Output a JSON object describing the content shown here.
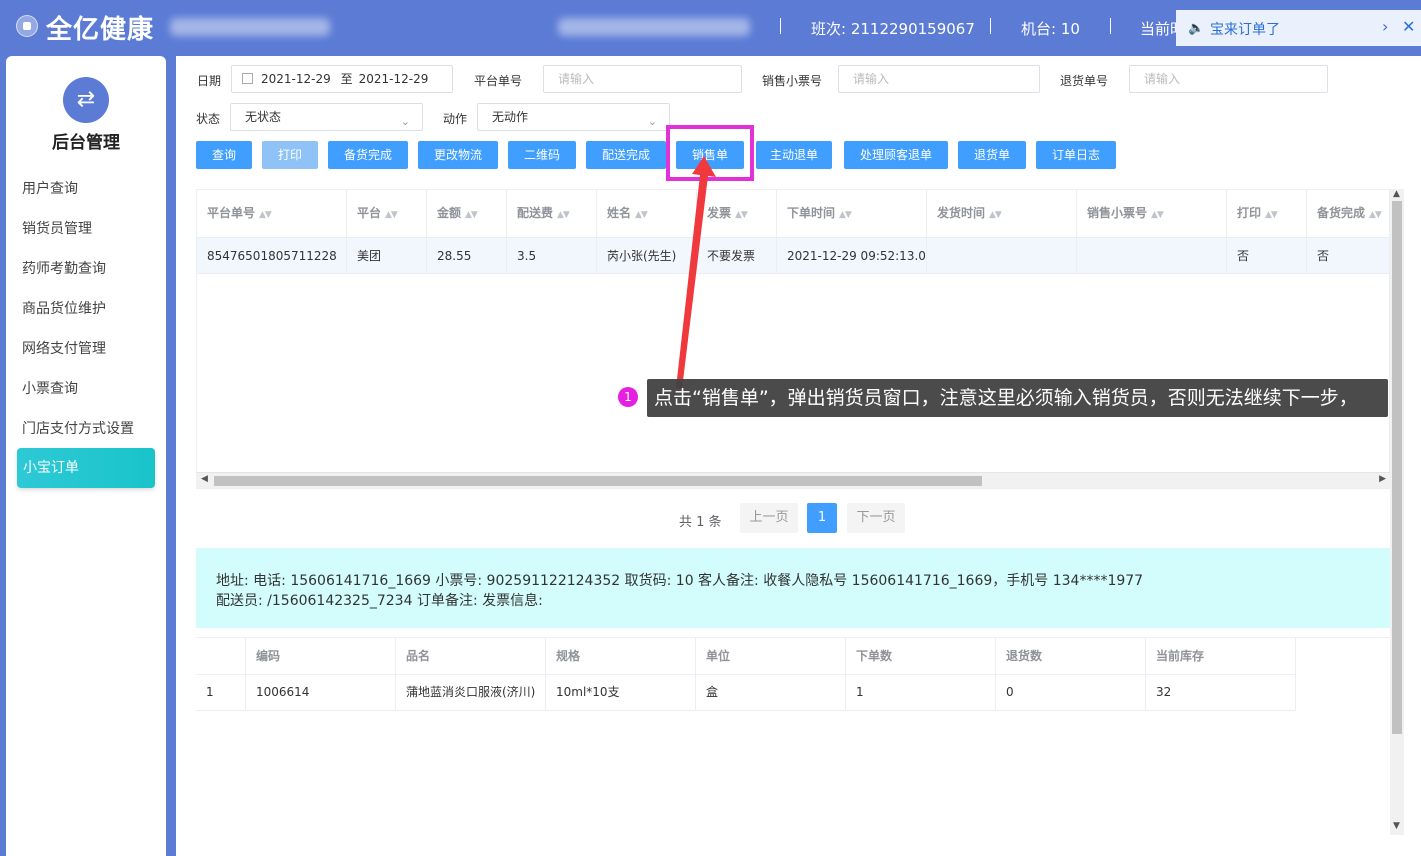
{
  "header": {
    "brand": "全亿健康",
    "shift_label": "班次: 2112290159067",
    "machine_label": "机台: 10",
    "current_label": "当前时",
    "notification": "宝来订单了"
  },
  "sidebar": {
    "title": "后台管理",
    "items": [
      {
        "label": "用户查询"
      },
      {
        "label": "销货员管理"
      },
      {
        "label": "药师考勤查询"
      },
      {
        "label": "商品货位维护"
      },
      {
        "label": "网络支付管理"
      },
      {
        "label": "小票查询"
      },
      {
        "label": "门店支付方式设置"
      },
      {
        "label": "小宝订单"
      }
    ]
  },
  "filters": {
    "date_label": "日期",
    "date_from": "2021-12-29",
    "date_sep": "至",
    "date_to": "2021-12-29",
    "platform_no_label": "平台单号",
    "platform_no_placeholder": "请输入",
    "sale_ticket_label": "销售小票号",
    "sale_ticket_placeholder": "请输入",
    "return_no_label": "退货单号",
    "return_no_placeholder": "请输入",
    "status_label": "状态",
    "status_value": "无状态",
    "action_label": "动作",
    "action_value": "无动作"
  },
  "toolbar": {
    "buttons": [
      "查询",
      "打印",
      "备货完成",
      "更改物流",
      "二维码",
      "配送完成",
      "销售单",
      "主动退单",
      "处理顾客退单",
      "退货单",
      "订单日志"
    ]
  },
  "orders": {
    "columns": [
      "平台单号",
      "平台",
      "金额",
      "配送费",
      "姓名",
      "发票",
      "下单时间",
      "发货时间",
      "销售小票号",
      "打印",
      "备货完成"
    ],
    "rows": [
      [
        "85476501805711228",
        "美团",
        "28.55",
        "3.5",
        "芮小张(先生)",
        "不要发票",
        "2021-12-29 09:52:13.0",
        "",
        "",
        "否",
        "否"
      ]
    ]
  },
  "annotation": {
    "number": "1",
    "text": "点击“销售单”，弹出销货员窗口，注意这里必须输入销货员，否则无法继续下一步，"
  },
  "pager": {
    "total": "共 1 条",
    "prev": "上一页",
    "current": "1",
    "next": "下一页"
  },
  "info": {
    "line1": "地址:      电话: 15606141716_1669    小票号: 902591122124352    取货码: 10    客人备注: 收餐人隐私号 15606141716_1669，手机号 134****1977",
    "line2": "配送员: /15606142325_7234    订单备注:      发票信息:"
  },
  "details": {
    "columns": [
      "",
      "编码",
      "品名",
      "规格",
      "单位",
      "下单数",
      "退货数",
      "当前库存"
    ],
    "rows": [
      [
        "1",
        "1006614",
        "蒲地蓝消炎口服液(济川)",
        "10ml*10支",
        "盒",
        "1",
        "0",
        "32"
      ]
    ]
  },
  "colors": {
    "header_bg": "#5b7bd5",
    "primary_button": "#409eff",
    "active_menu": "#1fc6cf",
    "highlight_border": "#e331d9",
    "info_bg": "#d3fcfc"
  }
}
